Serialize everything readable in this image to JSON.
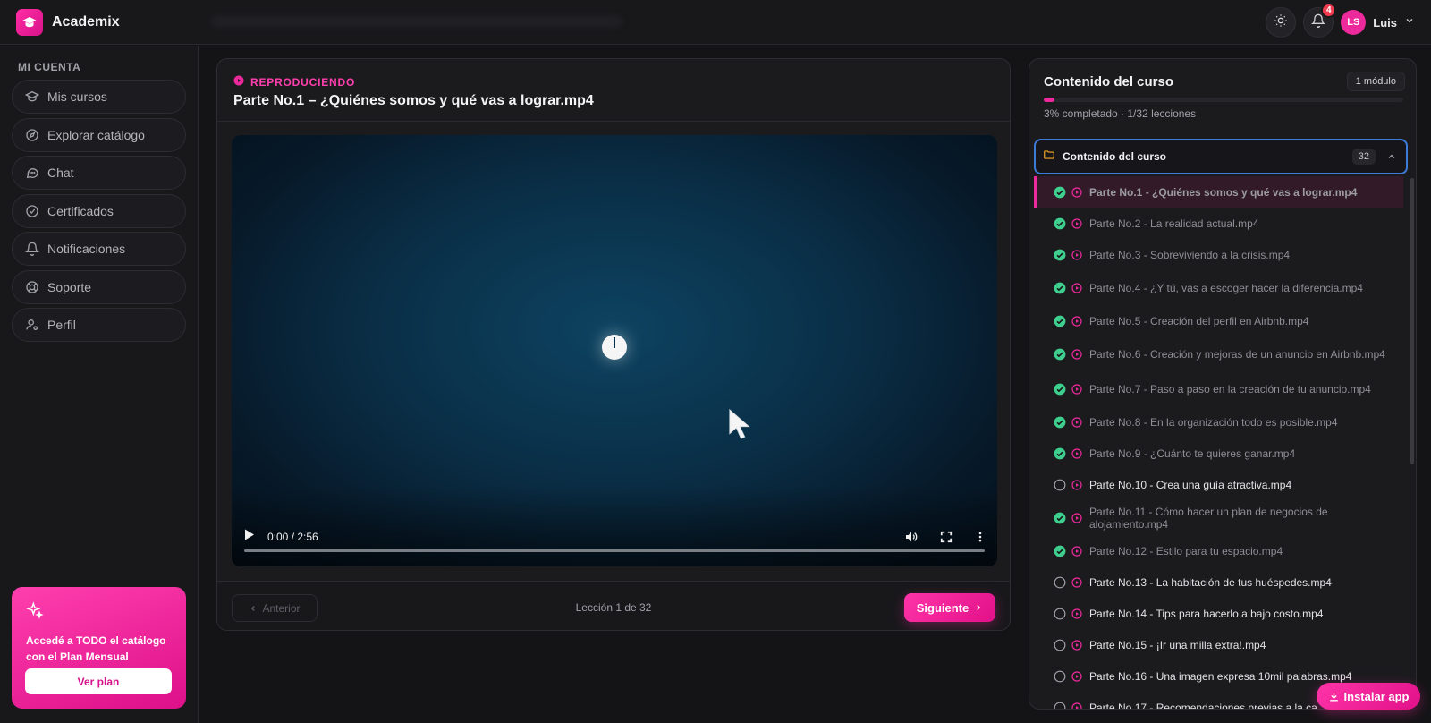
{
  "app": {
    "name": "Academix"
  },
  "header": {
    "notifications_count": "4",
    "user": {
      "initials": "LS",
      "name": "Luis"
    }
  },
  "sidebar": {
    "section_title": "MI CUENTA",
    "items": [
      {
        "label": "Mis cursos",
        "icon": "graduation-cap-icon"
      },
      {
        "label": "Explorar catálogo",
        "icon": "compass-icon"
      },
      {
        "label": "Chat",
        "icon": "chat-bubble-icon"
      },
      {
        "label": "Certificados",
        "icon": "badge-check-icon"
      },
      {
        "label": "Notificaciones",
        "icon": "bell-icon"
      },
      {
        "label": "Soporte",
        "icon": "lifebuoy-icon"
      },
      {
        "label": "Perfil",
        "icon": "user-gear-icon"
      }
    ],
    "promo": {
      "text": "Accedé a TODO el catálogo con el Plan Mensual",
      "button": "Ver plan"
    }
  },
  "player": {
    "status": "REPRODUCIENDO",
    "title": "Parte No.1 – ¿Quiénes somos y qué vas a lograr.mp4",
    "time": "0:00 / 2:56",
    "progress": 0,
    "prev_label": "Anterior",
    "next_label": "Siguiente",
    "lesson_counter": "Lección 1 de 32"
  },
  "course": {
    "title": "Contenido del curso",
    "modules": "1 módulo",
    "progress_percent": 3,
    "progress_text": "3% completado · 1/32 lecciones",
    "section": {
      "title": "Contenido del curso",
      "count": "32",
      "lessons": [
        {
          "title": "Parte No.1 - ¿Quiénes somos y qué vas a lograr.mp4",
          "done": true,
          "active": true
        },
        {
          "title": "Parte No.2 - La realidad actual.mp4",
          "done": true
        },
        {
          "title": "Parte No.3 - Sobreviviendo a la crisis.mp4",
          "done": true
        },
        {
          "title": "Parte No.4 - ¿Y tú, vas a escoger hacer la diferencia.mp4",
          "done": true
        },
        {
          "title": "Parte No.5 - Creación del perfil en Airbnb.mp4",
          "done": true
        },
        {
          "title": "Parte No.6 - Creación y mejoras de un anuncio en Airbnb.mp4",
          "done": true
        },
        {
          "title": "Parte No.7 - Paso a paso en la creación de tu anuncio.mp4",
          "done": true
        },
        {
          "title": "Parte No.8 - En la organización todo es posible.mp4",
          "done": true
        },
        {
          "title": "Parte No.9 - ¿Cuánto te quieres ganar.mp4",
          "done": true
        },
        {
          "title": "Parte No.10 - Crea una guía atractiva.mp4",
          "done": false
        },
        {
          "title": "Parte No.11 - Cómo hacer un plan de negocios de alojamiento.mp4",
          "done": true
        },
        {
          "title": "Parte No.12 - Estilo para tu espacio.mp4",
          "done": true
        },
        {
          "title": "Parte No.13 - La habitación de tus huéspedes.mp4",
          "done": false
        },
        {
          "title": "Parte No.14 - Tips para hacerlo a bajo costo.mp4",
          "done": false
        },
        {
          "title": "Parte No.15 - ¡Ir una milla extra!.mp4",
          "done": false
        },
        {
          "title": "Parte No.16 - Una imagen expresa 10mil palabras.mp4",
          "done": false
        },
        {
          "title": "Parte No.17 - Recomendaciones previas a la ca",
          "done": false
        }
      ]
    }
  },
  "install_label": "Instalar app",
  "colors": {
    "accent": "#ec2a9b",
    "done": "#3ecf8e",
    "focus": "#3d7bd9"
  }
}
